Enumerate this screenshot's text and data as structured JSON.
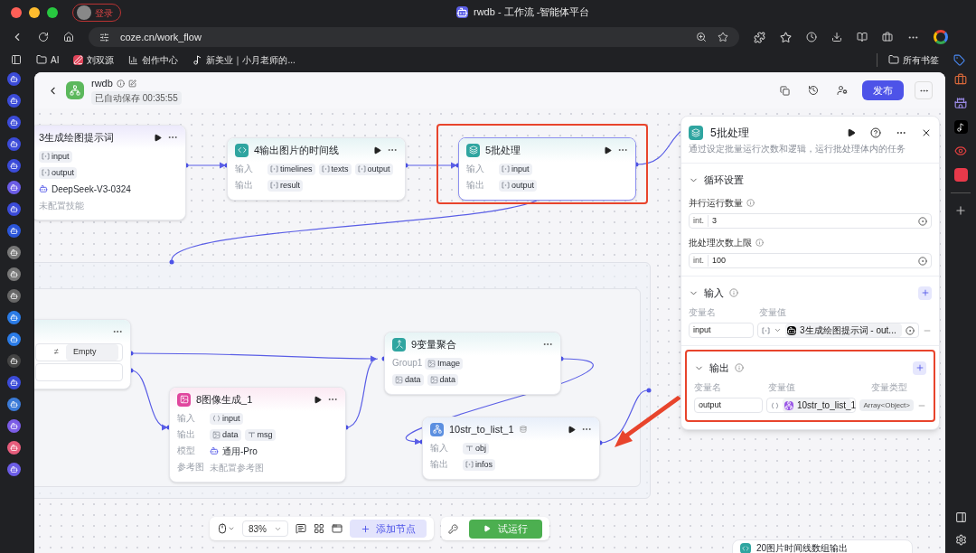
{
  "browser": {
    "profile_label": "登录",
    "tab_title": "rwdb - 工作流 -智能体平台",
    "url": "coze.cn/work_flow",
    "bookmarks": [
      {
        "kind": "folder",
        "label": "AI"
      },
      {
        "kind": "red",
        "label": "刘双源"
      },
      {
        "kind": "bars",
        "label": "创作中心"
      },
      {
        "kind": "note",
        "label": "新美业｜小月老师的..."
      }
    ],
    "all_bookmarks": "所有书签"
  },
  "header": {
    "title": "rwdb",
    "autosave": "已自动保存 00:35:55",
    "publish": "发布"
  },
  "nodes": [
    {
      "kind": "llm",
      "title": "3生成绘图提示词",
      "runnable": true,
      "selected": false,
      "annotated": false,
      "rows": [
        {
          "kind": "vars",
          "vars": [
            {
              "kind": "array",
              "name": "input"
            }
          ]
        },
        {
          "kind": "vars",
          "vars": [
            {
              "kind": "array",
              "name": "output"
            }
          ]
        },
        {
          "kind": "model",
          "text": "DeepSeek-V3-0324"
        },
        {
          "kind": "note",
          "text": "未配置技能"
        }
      ]
    },
    {
      "kind": "code",
      "title": "4输出图片的时间线",
      "runnable": true,
      "selected": false,
      "annotated": false,
      "rows": [
        {
          "kind": "vars",
          "label": "输入",
          "vars": [
            {
              "kind": "array",
              "name": "timelines"
            },
            {
              "kind": "array",
              "name": "texts"
            },
            {
              "kind": "array",
              "name": "output"
            }
          ]
        },
        {
          "kind": "vars",
          "label": "输出",
          "vars": [
            {
              "kind": "array",
              "name": "result"
            }
          ]
        }
      ]
    },
    {
      "kind": "batch",
      "title": "5批处理",
      "runnable": true,
      "selected": true,
      "annotated": true,
      "rows": [
        {
          "kind": "vars",
          "label": "输入",
          "vars": [
            {
              "kind": "array",
              "name": "input"
            }
          ]
        },
        {
          "kind": "vars",
          "label": "输出",
          "vars": [
            {
              "kind": "array",
              "name": "output"
            }
          ]
        }
      ]
    },
    {
      "kind": "condition",
      "runnable": false,
      "selected": false,
      "annotated": false,
      "rows": [
        {
          "kind": "condition",
          "operator": "≠",
          "value": "Empty"
        },
        {
          "kind": "field"
        }
      ]
    },
    {
      "kind": "image",
      "title": "8图像生成_1",
      "runnable": true,
      "selected": false,
      "annotated": false,
      "rows": [
        {
          "kind": "vars",
          "label": "输入",
          "vars": [
            {
              "kind": "object",
              "name": "input"
            }
          ]
        },
        {
          "kind": "vars",
          "label": "输出",
          "vars": [
            {
              "kind": "image",
              "name": "data"
            },
            {
              "kind": "string",
              "name": "msg"
            }
          ]
        },
        {
          "kind": "model",
          "label": "模型",
          "text": "通用-Pro"
        },
        {
          "kind": "note",
          "label": "参考图",
          "text": "未配置参考图"
        }
      ]
    },
    {
      "kind": "merge",
      "title": "9变量聚合",
      "runnable": false,
      "selected": false,
      "annotated": false,
      "rows": [
        {
          "kind": "vars",
          "label": "Group1",
          "vars": [
            {
              "kind": "image",
              "name": "Image"
            }
          ]
        },
        {
          "kind": "vars",
          "vars": [
            {
              "kind": "image",
              "name": "data"
            },
            {
              "kind": "image",
              "name": "data"
            }
          ]
        }
      ]
    },
    {
      "kind": "plugin",
      "title": "10str_to_list_1",
      "runnable": true,
      "selected": false,
      "annotated": false,
      "rows": [
        {
          "kind": "vars",
          "label": "输入",
          "vars": [
            {
              "kind": "string",
              "name": "obj"
            }
          ]
        },
        {
          "kind": "vars",
          "label": "输出",
          "vars": [
            {
              "kind": "array",
              "name": "infos"
            }
          ]
        }
      ]
    }
  ],
  "bottom_node": {
    "title": "20图片时间线数组输出"
  },
  "panel": {
    "title": "5批处理",
    "description": "通过设定批量运行次数和逻辑，运行批处理体内的任务",
    "sections": [
      {
        "kind": "settings",
        "title": "循环设置",
        "expanded": true,
        "highlighted": false,
        "fields": [
          {
            "label": "并行运行数量",
            "type": "int.",
            "value": "3"
          },
          {
            "label": "批处理次数上限",
            "type": "int.",
            "value": "100"
          }
        ]
      },
      {
        "kind": "input",
        "title": "输入",
        "expanded": true,
        "highlighted": false,
        "columns": [
          "变量名",
          "变量值"
        ],
        "rows": [
          {
            "name": "input",
            "kind": "array",
            "source": "3生成绘图提示词 - out..."
          }
        ]
      },
      {
        "kind": "output",
        "title": "输出",
        "expanded": true,
        "highlighted": true,
        "columns": [
          "变量名",
          "变量值",
          "变量类型"
        ],
        "rows": [
          {
            "name": "output",
            "kind": "object",
            "source": "10str_to_list_1",
            "type": "Array<Object>"
          }
        ]
      }
    ]
  },
  "toolbar": {
    "zoom": "83%",
    "add_node": "添加节点",
    "test_run": "试运行"
  }
}
